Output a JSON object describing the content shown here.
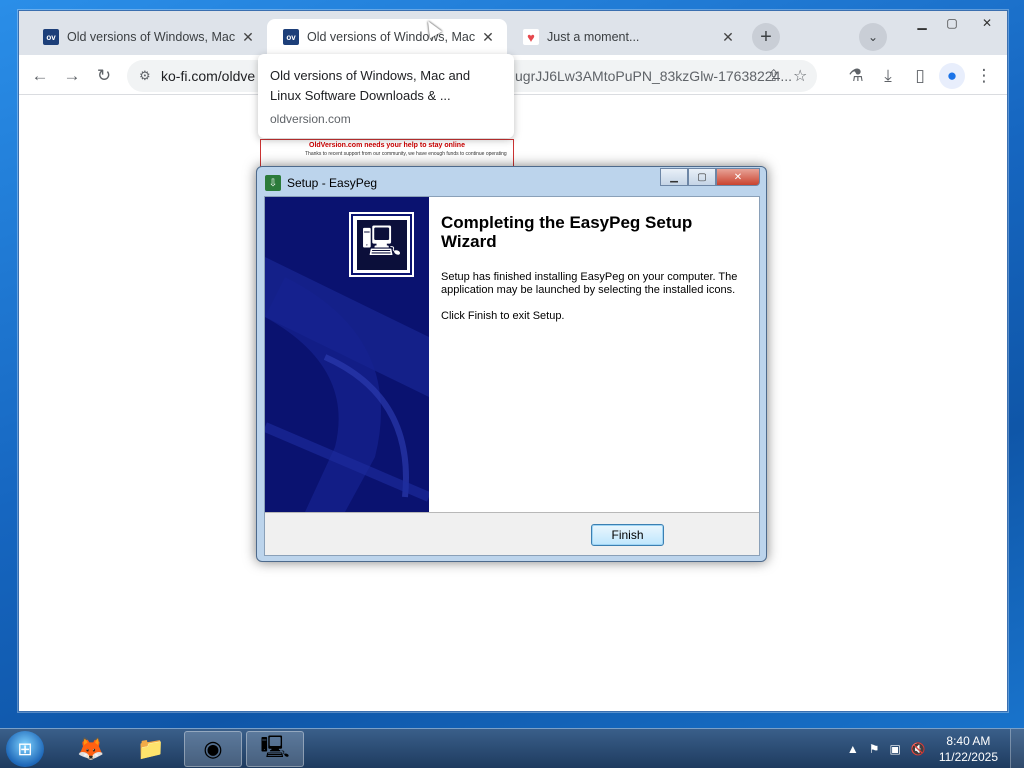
{
  "browser": {
    "tabs": [
      {
        "title": "Old versions of Windows, Mac a",
        "favicon": "ov",
        "close": "✕"
      },
      {
        "title": "Old versions of Windows, Mac a",
        "favicon": "ov",
        "close": "✕"
      },
      {
        "title": "Just a moment...",
        "favicon": "ko-fi-cup",
        "close": "✕"
      }
    ],
    "url_left": "ko-fi.com/oldve",
    "url_right": "ugrJJ6Lw3AMtoPuPN_83kzGlw-17638224...",
    "hover_card": {
      "title": "Old versions of Windows, Mac and Linux Software Downloads & ...",
      "domain": "oldversion.com"
    },
    "page_preview": {
      "banner": "OldVersion.com needs your help to stay online",
      "text": "Thanks to recent support from our community, we have enough funds to continue operating"
    }
  },
  "dialog": {
    "title": "Setup - EasyPeg",
    "heading": "Completing the EasyPeg Setup Wizard",
    "body": "Setup has finished installing EasyPeg on your computer. The application may be launched by selecting the installed icons.",
    "exit_hint": "Click Finish to exit Setup.",
    "finish_label": "Finish"
  },
  "taskbar": {
    "time": "8:40 AM",
    "date": "11/22/2025"
  },
  "colors": {
    "wizard_side": "#0a1270",
    "desktop": "#1a6fc7",
    "taskbar": "#1e3b5f"
  }
}
